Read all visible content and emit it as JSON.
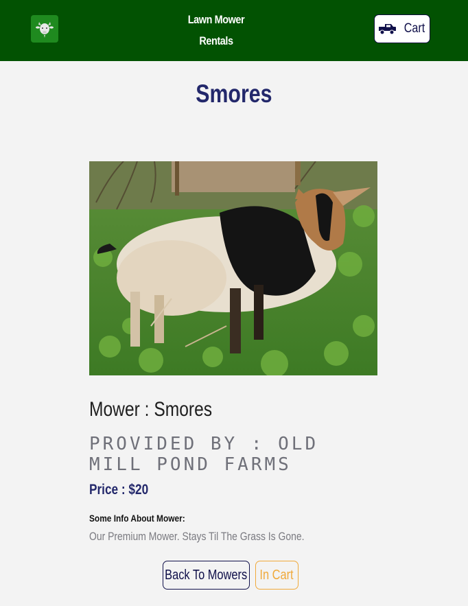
{
  "navbar": {
    "logo_icon": "goat-head-icon",
    "brand_line1": "Lawn Mower",
    "brand_line2": "Rentals",
    "cart_icon": "truck-icon",
    "cart_label": "Cart"
  },
  "page": {
    "title": "Smores",
    "image_subject": "goat-photo"
  },
  "details": {
    "mower_line": "Mower : Smores",
    "provider_line": "Provided By : Old Mill Pond Farms",
    "price_line": "Price : $20",
    "info_label": "Some Info About Mower:",
    "info_text": "Our Premium Mower. Stays Til The Grass Is Gone."
  },
  "actions": {
    "back_label": "Back To Mowers",
    "incart_label": "In Cart"
  },
  "colors": {
    "navbar": "#025202",
    "title": "#23286b",
    "in_cart": "#f0a93a"
  }
}
